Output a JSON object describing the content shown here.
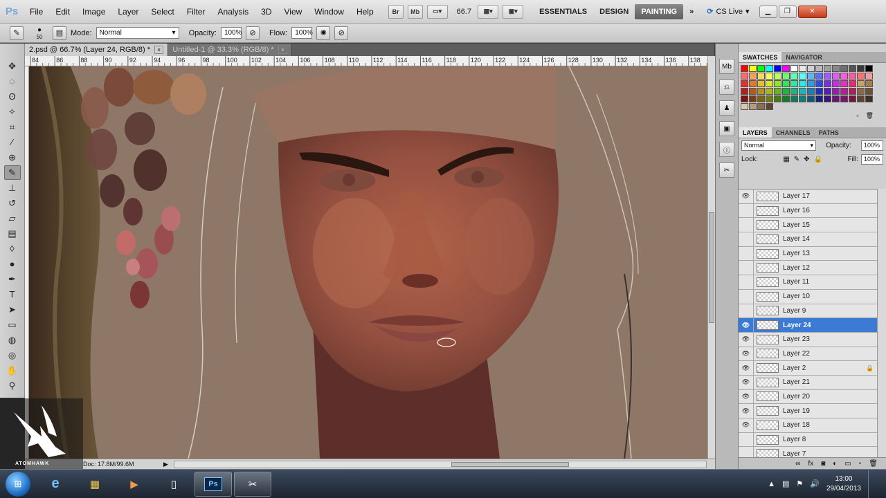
{
  "app": {
    "logo": "Ps",
    "menu": [
      "File",
      "Edit",
      "Image",
      "Layer",
      "Select",
      "Filter",
      "Analysis",
      "3D",
      "View",
      "Window",
      "Help"
    ],
    "bridge_btn": "Br",
    "minibridge_btn": "Mb",
    "zoom": "66.7",
    "workspaces": [
      "ESSENTIALS",
      "DESIGN",
      "PAINTING"
    ],
    "active_workspace": "PAINTING",
    "more": "»",
    "cslive": "CS Live"
  },
  "options": {
    "brush_size": "50",
    "mode_label": "Mode:",
    "mode_value": "Normal",
    "opacity_label": "Opacity:",
    "opacity_value": "100%",
    "flow_label": "Flow:",
    "flow_value": "100%"
  },
  "tabs": [
    {
      "label": "2.psd @ 66.7% (Layer 24, RGB/8) *",
      "close": "×"
    },
    {
      "label": "Untitled-1 @ 33.3% (RGB/8) *",
      "close": "×"
    }
  ],
  "ruler_ticks": [
    "84",
    "86",
    "88",
    "90",
    "92",
    "94",
    "96",
    "98",
    "100",
    "102",
    "104",
    "106",
    "108",
    "110",
    "112",
    "114",
    "116",
    "118",
    "120",
    "122",
    "124",
    "126",
    "128",
    "130",
    "132",
    "134",
    "136",
    "138"
  ],
  "status": {
    "doc_info": "Doc: 17.8M/99.6M"
  },
  "panels": {
    "swatch_tabs": [
      "SWATCHES",
      "NAVIGATOR"
    ],
    "layer_tabs": [
      "LAYERS",
      "CHANNELS",
      "PATHS"
    ],
    "blend_mode": "Normal",
    "opacity_label": "Opacity:",
    "opacity_value": "100%",
    "lock_label": "Lock:",
    "fill_label": "Fill:",
    "fill_value": "100%",
    "swatch_colors": [
      "#ff0000",
      "#ffff00",
      "#00ff00",
      "#00ffff",
      "#0000ff",
      "#ff00ff",
      "#ffffff",
      "#e6e6e6",
      "#d0d0d0",
      "#b8b8b8",
      "#a0a0a0",
      "#888888",
      "#6e6e6e",
      "#555555",
      "#3a3a3a",
      "#000000",
      "#ff6b6b",
      "#ff9f5a",
      "#ffd75a",
      "#f7ff5a",
      "#b7ff5a",
      "#6bff6b",
      "#5affb0",
      "#5affff",
      "#5ab7ff",
      "#5a6bff",
      "#9f5aff",
      "#e05aff",
      "#ff5ae0",
      "#ff5a9f",
      "#ff7070",
      "#ff9a9a",
      "#e62e2e",
      "#e6772e",
      "#e6bf2e",
      "#d8e62e",
      "#8ee62e",
      "#2ee65a",
      "#2ee6a6",
      "#2ee6e6",
      "#2e9fe6",
      "#2e4ae6",
      "#772ee6",
      "#c42ee6",
      "#e62ec4",
      "#e62e77",
      "#c8a06a",
      "#a87c48",
      "#b51e1e",
      "#b5591e",
      "#b5911e",
      "#a8b51e",
      "#6ab51e",
      "#1eb543",
      "#1eb57d",
      "#1eb5b5",
      "#1e7db5",
      "#1e33b5",
      "#591eb5",
      "#971eb5",
      "#b51e97",
      "#b51e59",
      "#8a6a42",
      "#6b4f2e",
      "#7a1414",
      "#7a3c14",
      "#7a6214",
      "#727a14",
      "#487a14",
      "#147a2d",
      "#147a55",
      "#147a7a",
      "#14557a",
      "#14227a",
      "#3c147a",
      "#66147a",
      "#7a1466",
      "#7a143c",
      "#5c4530",
      "#3f2e1e",
      "#d9c8a8",
      "#b89c78",
      "#8a6e4e",
      "#5e4630"
    ],
    "layers": [
      {
        "name": "Layer 17",
        "visible": true,
        "selected": false,
        "locked": false
      },
      {
        "name": "Layer 16",
        "visible": false,
        "selected": false,
        "locked": false
      },
      {
        "name": "Layer 15",
        "visible": false,
        "selected": false,
        "locked": false
      },
      {
        "name": "Layer 14",
        "visible": false,
        "selected": false,
        "locked": false
      },
      {
        "name": "Layer 13",
        "visible": false,
        "selected": false,
        "locked": false
      },
      {
        "name": "Layer 12",
        "visible": false,
        "selected": false,
        "locked": false
      },
      {
        "name": "Layer 11",
        "visible": false,
        "selected": false,
        "locked": false
      },
      {
        "name": "Layer 10",
        "visible": false,
        "selected": false,
        "locked": false
      },
      {
        "name": "Layer 9",
        "visible": false,
        "selected": false,
        "locked": false
      },
      {
        "name": "Layer 24",
        "visible": true,
        "selected": true,
        "locked": false
      },
      {
        "name": "Layer 23",
        "visible": true,
        "selected": false,
        "locked": false
      },
      {
        "name": "Layer 22",
        "visible": true,
        "selected": false,
        "locked": false
      },
      {
        "name": "Layer 2",
        "visible": true,
        "selected": false,
        "locked": true
      },
      {
        "name": "Layer 21",
        "visible": true,
        "selected": false,
        "locked": false
      },
      {
        "name": "Layer 20",
        "visible": true,
        "selected": false,
        "locked": false
      },
      {
        "name": "Layer 19",
        "visible": true,
        "selected": false,
        "locked": false
      },
      {
        "name": "Layer 18",
        "visible": true,
        "selected": false,
        "locked": false
      },
      {
        "name": "Layer 8",
        "visible": false,
        "selected": false,
        "locked": false
      },
      {
        "name": "Layer 7",
        "visible": false,
        "selected": false,
        "locked": false
      }
    ]
  },
  "taskbar": {
    "start": "⊞",
    "apps": [
      {
        "name": "internet-explorer",
        "glyph": "e"
      },
      {
        "name": "file-explorer",
        "glyph": "▦"
      },
      {
        "name": "media-player",
        "glyph": "▶"
      },
      {
        "name": "document",
        "glyph": "▯"
      },
      {
        "name": "photoshop",
        "glyph": "Ps"
      },
      {
        "name": "snipping-tool",
        "glyph": "✂"
      }
    ],
    "time": "13:00",
    "date": "29/04/2013"
  },
  "watermark": {
    "text": "ATOMHAWK"
  }
}
